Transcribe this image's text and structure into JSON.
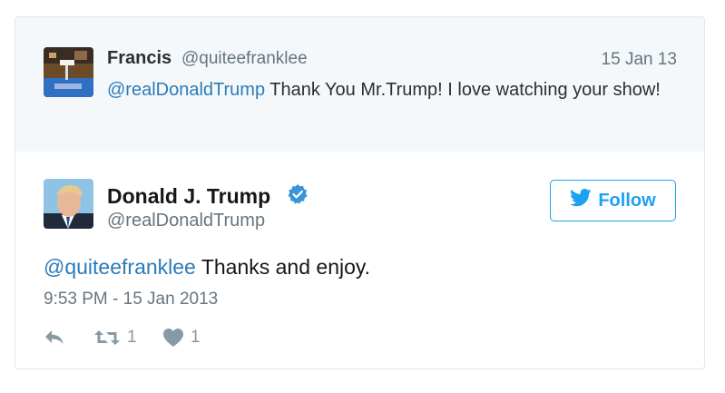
{
  "quoted_tweet": {
    "name": "Francis",
    "handle": "@quiteefranklee",
    "date": "15 Jan 13",
    "mention": "@realDonaldTrump",
    "text": " Thank You Mr.Trump! I love watching your show!"
  },
  "tweet": {
    "name": "Donald J. Trump",
    "handle": "@realDonaldTrump",
    "verified_icon": "verified-badge-icon",
    "follow_label": "Follow",
    "mention": "@quiteefranklee",
    "text": " Thanks and enjoy.",
    "timestamp": "9:53 PM - 15 Jan 2013",
    "retweet_count": "1",
    "like_count": "1"
  },
  "colors": {
    "link": "#2b7bb9",
    "follow": "#1da1f2",
    "muted": "#66757f",
    "action": "#8899a6",
    "parent_bg": "#f5f8fa"
  }
}
